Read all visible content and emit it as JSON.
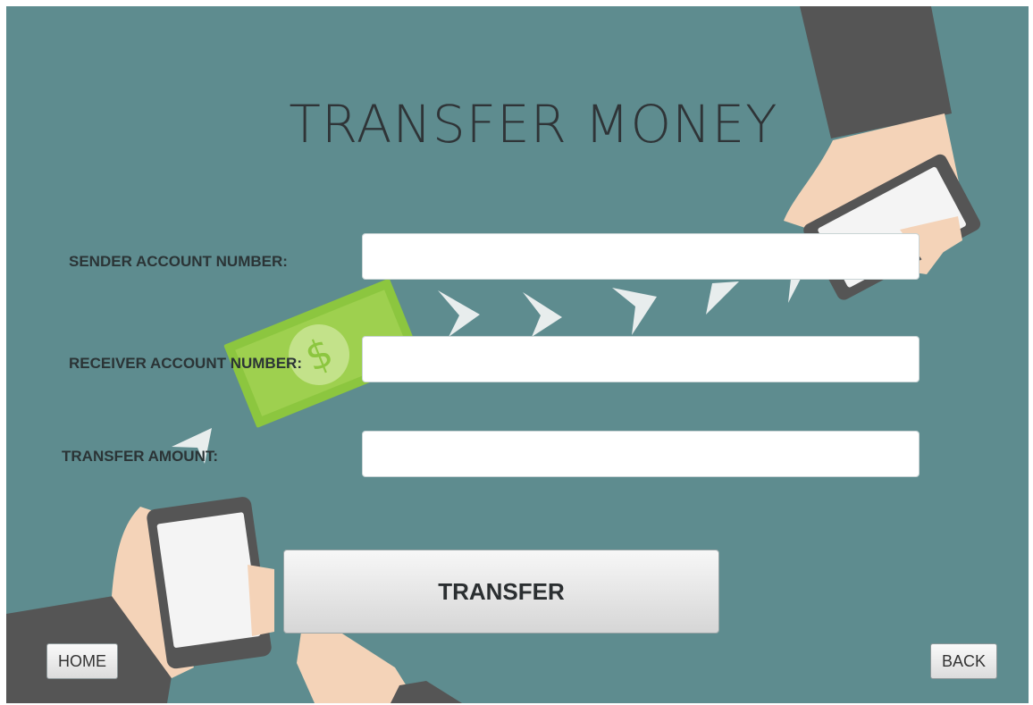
{
  "page": {
    "title": "TRANSFER MONEY"
  },
  "form": {
    "sender_label": "SENDER ACCOUNT NUMBER:",
    "sender_value": "",
    "receiver_label": "RECEIVER ACCOUNT NUMBER:",
    "receiver_value": "",
    "amount_label": "TRANSFER AMOUNT:",
    "amount_value": ""
  },
  "actions": {
    "transfer_label": "TRANSFER",
    "home_label": "HOME",
    "back_label": "BACK"
  },
  "colors": {
    "background": "#5e8c8f",
    "bill": "#8cc63f",
    "skin": "#f4d3b8",
    "sleeve": "#555555"
  }
}
